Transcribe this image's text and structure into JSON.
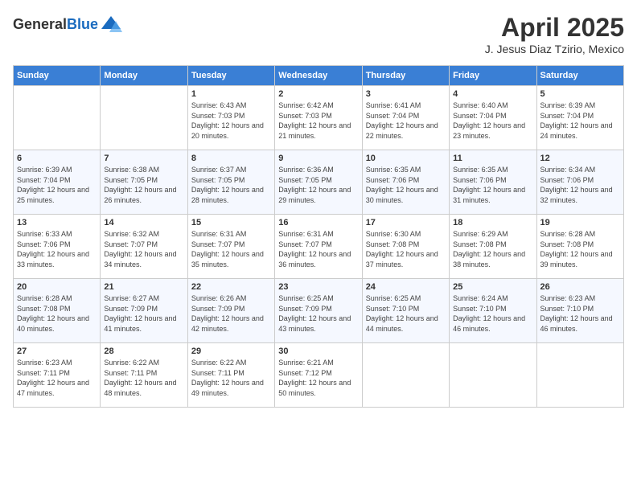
{
  "header": {
    "logo_general": "General",
    "logo_blue": "Blue",
    "month": "April 2025",
    "location": "J. Jesus Diaz Tzirio, Mexico"
  },
  "weekdays": [
    "Sunday",
    "Monday",
    "Tuesday",
    "Wednesday",
    "Thursday",
    "Friday",
    "Saturday"
  ],
  "weeks": [
    [
      {
        "day": "",
        "info": ""
      },
      {
        "day": "",
        "info": ""
      },
      {
        "day": "1",
        "info": "Sunrise: 6:43 AM\nSunset: 7:03 PM\nDaylight: 12 hours and 20 minutes."
      },
      {
        "day": "2",
        "info": "Sunrise: 6:42 AM\nSunset: 7:03 PM\nDaylight: 12 hours and 21 minutes."
      },
      {
        "day": "3",
        "info": "Sunrise: 6:41 AM\nSunset: 7:04 PM\nDaylight: 12 hours and 22 minutes."
      },
      {
        "day": "4",
        "info": "Sunrise: 6:40 AM\nSunset: 7:04 PM\nDaylight: 12 hours and 23 minutes."
      },
      {
        "day": "5",
        "info": "Sunrise: 6:39 AM\nSunset: 7:04 PM\nDaylight: 12 hours and 24 minutes."
      }
    ],
    [
      {
        "day": "6",
        "info": "Sunrise: 6:39 AM\nSunset: 7:04 PM\nDaylight: 12 hours and 25 minutes."
      },
      {
        "day": "7",
        "info": "Sunrise: 6:38 AM\nSunset: 7:05 PM\nDaylight: 12 hours and 26 minutes."
      },
      {
        "day": "8",
        "info": "Sunrise: 6:37 AM\nSunset: 7:05 PM\nDaylight: 12 hours and 28 minutes."
      },
      {
        "day": "9",
        "info": "Sunrise: 6:36 AM\nSunset: 7:05 PM\nDaylight: 12 hours and 29 minutes."
      },
      {
        "day": "10",
        "info": "Sunrise: 6:35 AM\nSunset: 7:06 PM\nDaylight: 12 hours and 30 minutes."
      },
      {
        "day": "11",
        "info": "Sunrise: 6:35 AM\nSunset: 7:06 PM\nDaylight: 12 hours and 31 minutes."
      },
      {
        "day": "12",
        "info": "Sunrise: 6:34 AM\nSunset: 7:06 PM\nDaylight: 12 hours and 32 minutes."
      }
    ],
    [
      {
        "day": "13",
        "info": "Sunrise: 6:33 AM\nSunset: 7:06 PM\nDaylight: 12 hours and 33 minutes."
      },
      {
        "day": "14",
        "info": "Sunrise: 6:32 AM\nSunset: 7:07 PM\nDaylight: 12 hours and 34 minutes."
      },
      {
        "day": "15",
        "info": "Sunrise: 6:31 AM\nSunset: 7:07 PM\nDaylight: 12 hours and 35 minutes."
      },
      {
        "day": "16",
        "info": "Sunrise: 6:31 AM\nSunset: 7:07 PM\nDaylight: 12 hours and 36 minutes."
      },
      {
        "day": "17",
        "info": "Sunrise: 6:30 AM\nSunset: 7:08 PM\nDaylight: 12 hours and 37 minutes."
      },
      {
        "day": "18",
        "info": "Sunrise: 6:29 AM\nSunset: 7:08 PM\nDaylight: 12 hours and 38 minutes."
      },
      {
        "day": "19",
        "info": "Sunrise: 6:28 AM\nSunset: 7:08 PM\nDaylight: 12 hours and 39 minutes."
      }
    ],
    [
      {
        "day": "20",
        "info": "Sunrise: 6:28 AM\nSunset: 7:08 PM\nDaylight: 12 hours and 40 minutes."
      },
      {
        "day": "21",
        "info": "Sunrise: 6:27 AM\nSunset: 7:09 PM\nDaylight: 12 hours and 41 minutes."
      },
      {
        "day": "22",
        "info": "Sunrise: 6:26 AM\nSunset: 7:09 PM\nDaylight: 12 hours and 42 minutes."
      },
      {
        "day": "23",
        "info": "Sunrise: 6:25 AM\nSunset: 7:09 PM\nDaylight: 12 hours and 43 minutes."
      },
      {
        "day": "24",
        "info": "Sunrise: 6:25 AM\nSunset: 7:10 PM\nDaylight: 12 hours and 44 minutes."
      },
      {
        "day": "25",
        "info": "Sunrise: 6:24 AM\nSunset: 7:10 PM\nDaylight: 12 hours and 46 minutes."
      },
      {
        "day": "26",
        "info": "Sunrise: 6:23 AM\nSunset: 7:10 PM\nDaylight: 12 hours and 46 minutes."
      }
    ],
    [
      {
        "day": "27",
        "info": "Sunrise: 6:23 AM\nSunset: 7:11 PM\nDaylight: 12 hours and 47 minutes."
      },
      {
        "day": "28",
        "info": "Sunrise: 6:22 AM\nSunset: 7:11 PM\nDaylight: 12 hours and 48 minutes."
      },
      {
        "day": "29",
        "info": "Sunrise: 6:22 AM\nSunset: 7:11 PM\nDaylight: 12 hours and 49 minutes."
      },
      {
        "day": "30",
        "info": "Sunrise: 6:21 AM\nSunset: 7:12 PM\nDaylight: 12 hours and 50 minutes."
      },
      {
        "day": "",
        "info": ""
      },
      {
        "day": "",
        "info": ""
      },
      {
        "day": "",
        "info": ""
      }
    ]
  ]
}
